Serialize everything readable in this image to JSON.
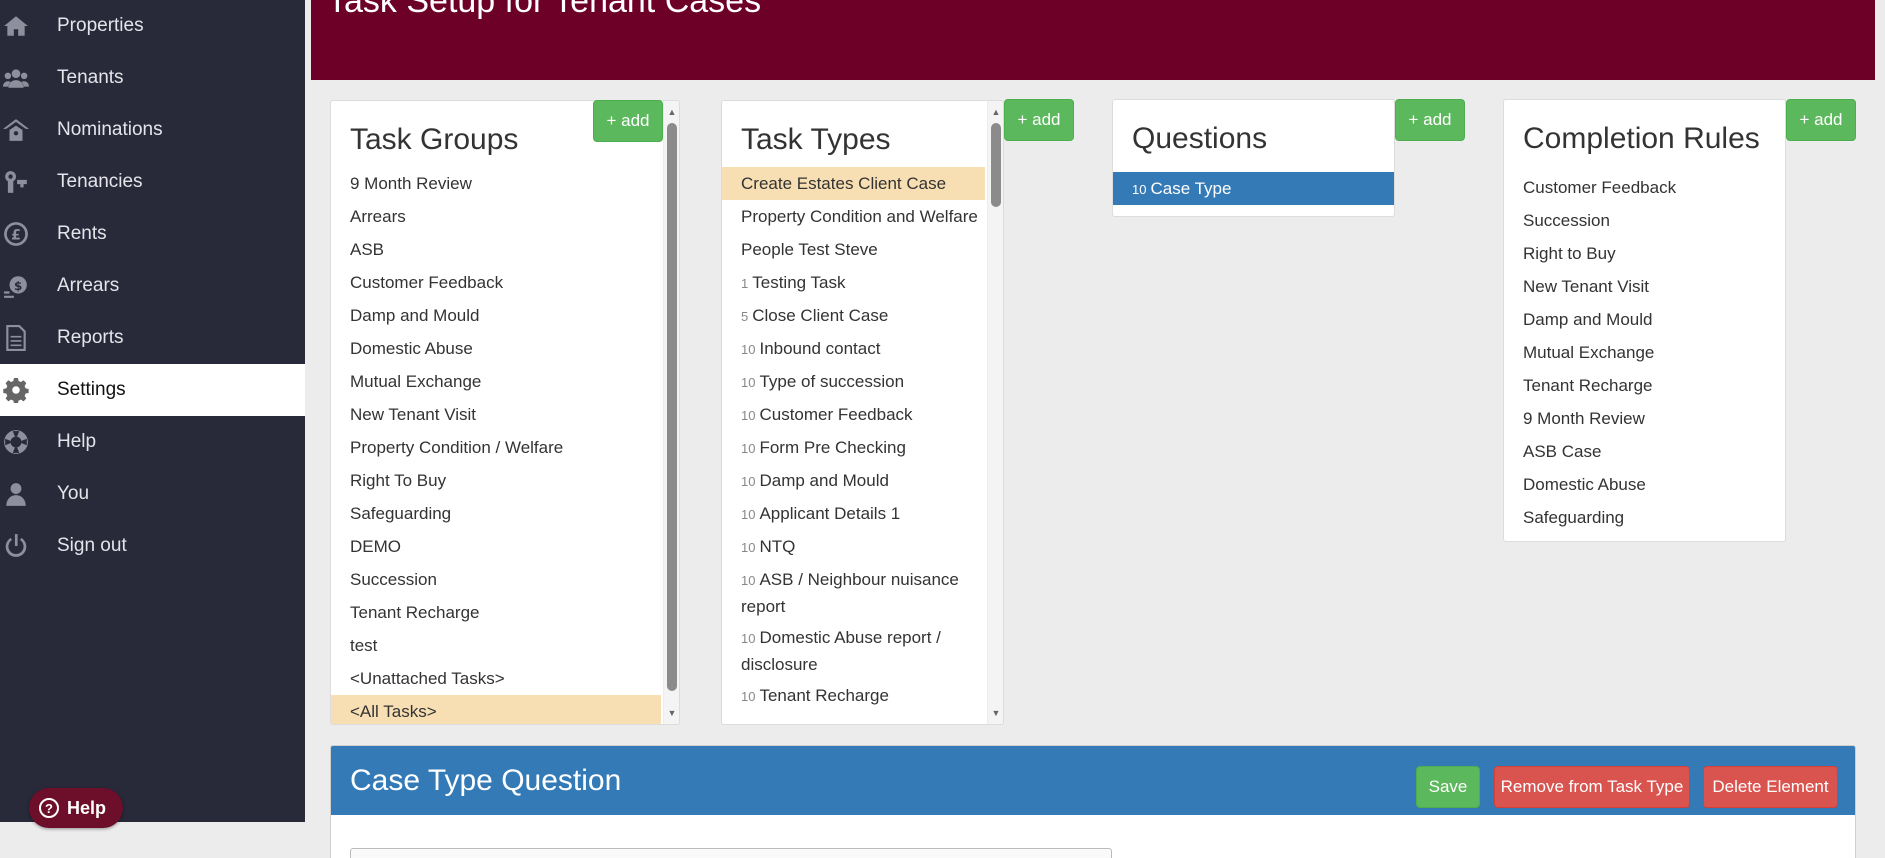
{
  "nav": {
    "items": [
      {
        "label": "Properties",
        "icon": "home-icon"
      },
      {
        "label": "Tenants",
        "icon": "users-icon"
      },
      {
        "label": "Nominations",
        "icon": "nominations-icon"
      },
      {
        "label": "Tenancies",
        "icon": "keys-icon"
      },
      {
        "label": "Rents",
        "icon": "pound-icon"
      },
      {
        "label": "Arrears",
        "icon": "arrears-icon"
      },
      {
        "label": "Reports",
        "icon": "document-icon"
      },
      {
        "label": "Settings",
        "icon": "gear-icon",
        "active": true
      },
      {
        "label": "Help",
        "icon": "lifebuoy-icon"
      },
      {
        "label": "You",
        "icon": "user-icon"
      },
      {
        "label": "Sign out",
        "icon": "power-icon"
      }
    ],
    "help_button": "Help"
  },
  "header": {
    "title": "Task Setup for Tenant Cases"
  },
  "add_label": "+ add",
  "task_groups": {
    "title": "Task Groups",
    "items": [
      "9 Month Review",
      "Arrears",
      "ASB",
      "Customer Feedback",
      "Damp and Mould",
      "Domestic Abuse",
      "Mutual Exchange",
      "New Tenant Visit",
      "Property Condition / Welfare",
      "Right To Buy",
      "Safeguarding",
      "DEMO",
      "Succession",
      "Tenant Recharge",
      "test",
      "<Unattached Tasks>",
      "<All Tasks>"
    ],
    "highlighted": "<All Tasks>"
  },
  "task_types": {
    "title": "Task Types",
    "items": [
      {
        "num": "",
        "label": "Create Estates Client Case",
        "highlighted": true
      },
      {
        "num": "",
        "label": "Property Condition and Welfare"
      },
      {
        "num": "",
        "label": "People Test Steve"
      },
      {
        "num": "1",
        "label": "Testing Task"
      },
      {
        "num": "5",
        "label": "Close Client Case"
      },
      {
        "num": "10",
        "label": "Inbound contact"
      },
      {
        "num": "10",
        "label": "Type of succession"
      },
      {
        "num": "10",
        "label": "Customer Feedback"
      },
      {
        "num": "10",
        "label": "Form Pre Checking"
      },
      {
        "num": "10",
        "label": "Damp and Mould"
      },
      {
        "num": "10",
        "label": "Applicant Details 1"
      },
      {
        "num": "10",
        "label": "NTQ"
      },
      {
        "num": "10",
        "label": "ASB / Neighbour nuisance report",
        "tall": true
      },
      {
        "num": "10",
        "label": "Domestic Abuse report / disclosure",
        "tall": true
      },
      {
        "num": "10",
        "label": "Tenant Recharge"
      }
    ]
  },
  "questions": {
    "title": "Questions",
    "items": [
      {
        "num": "10",
        "label": "Case Type",
        "selected": true
      }
    ]
  },
  "completion_rules": {
    "title": "Completion Rules",
    "items": [
      "Customer Feedback",
      "Succession",
      "Right to Buy",
      "New Tenant Visit",
      "Damp and Mould",
      "Mutual Exchange",
      "Tenant Recharge",
      "9 Month Review",
      "ASB Case",
      "Domestic Abuse",
      "Safeguarding"
    ]
  },
  "case_panel": {
    "title": "Case Type Question",
    "save": "Save",
    "remove": "Remove from Task Type",
    "delete": "Delete Element"
  }
}
